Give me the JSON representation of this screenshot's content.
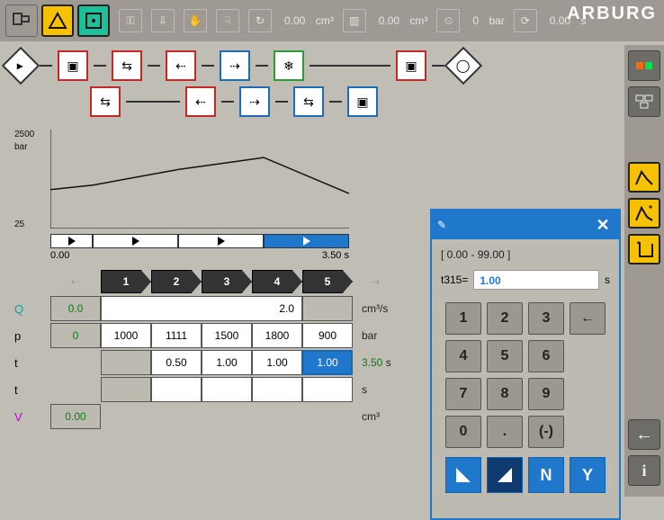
{
  "brand": "ARBURG",
  "top_status": {
    "v1": {
      "value": "0.00",
      "unit": "cm³"
    },
    "v2": {
      "value": "0.00",
      "unit": "cm³"
    },
    "v3": {
      "value": "0",
      "unit": "bar"
    },
    "v4": {
      "value": "0.00",
      "unit": "s"
    }
  },
  "flow": {
    "row1": [
      "start",
      "node-a",
      "node-b",
      "node-c",
      "node-d",
      "node-cool",
      "gap",
      "node-e",
      "stop"
    ],
    "row2": [
      "node-f",
      "node-g",
      "node-h",
      "node-i",
      "node-j",
      "node-k"
    ]
  },
  "chart_data": {
    "type": "line",
    "title": "",
    "xlabel": "s",
    "ylabel": "bar",
    "ylim": [
      25,
      2500
    ],
    "xlim": [
      0.0,
      3.5
    ],
    "x": [
      0.0,
      0.5,
      1.5,
      2.5,
      3.5
    ],
    "values": [
      1000,
      1111,
      1500,
      1800,
      900
    ],
    "ytick_labels": [
      "25",
      "2500"
    ],
    "xtick_labels": [
      "0.00",
      "3.50"
    ],
    "segment_bar": [
      {
        "start": 0.0,
        "end": 0.5,
        "active": false
      },
      {
        "start": 0.5,
        "end": 1.5,
        "active": false
      },
      {
        "start": 1.5,
        "end": 2.5,
        "active": false
      },
      {
        "start": 2.5,
        "end": 3.5,
        "active": true
      }
    ]
  },
  "stage_flags": [
    "1",
    "2",
    "3",
    "4",
    "5"
  ],
  "params": {
    "Q": {
      "label": "Q",
      "color": "#00a6a6",
      "left": "0.0",
      "main": "2.0",
      "unit": "cm³/s"
    },
    "p": {
      "label": "p",
      "color": "#111",
      "left": "0",
      "cells": [
        "1000",
        "1111",
        "1500",
        "1800",
        "900"
      ],
      "unit": "bar"
    },
    "t1": {
      "label": "t",
      "color": "#111",
      "cells": [
        "",
        "0.50",
        "1.00",
        "1.00",
        "1.00"
      ],
      "sum": "3.50",
      "unit": "s",
      "sel_index": 4
    },
    "t2": {
      "label": "t",
      "color": "#111",
      "cells": [
        "",
        "",
        "",
        "",
        ""
      ],
      "unit": "s"
    },
    "V": {
      "label": "V",
      "color": "#b800d9",
      "left": "0.00",
      "unit": "cm³"
    }
  },
  "keypad": {
    "range": "[ 0.00 - 99.00 ]",
    "param": "t315=",
    "value": "1.00",
    "unit": "s",
    "keys_row1": [
      "1",
      "2",
      "3",
      "←"
    ],
    "keys_row2": [
      "4",
      "5",
      "6",
      ""
    ],
    "keys_row3": [
      "7",
      "8",
      "9",
      ""
    ],
    "keys_row4": [
      "0",
      ".",
      "(-)",
      ""
    ],
    "actions": [
      "◣",
      "◢",
      "N",
      "Y"
    ]
  },
  "side_buttons": [
    "status-lights",
    "layout",
    "curve-a",
    "curve-b",
    "list",
    "back",
    "info"
  ]
}
